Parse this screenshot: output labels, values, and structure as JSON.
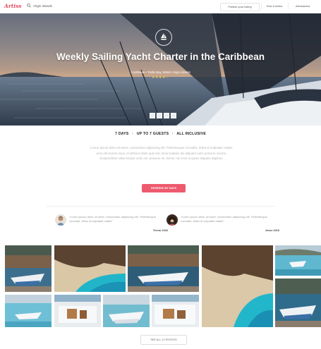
{
  "nav": {
    "logo": "Artiss",
    "search_value": "Virgin Islands",
    "publish_label": "Publish your listing",
    "how_label": "How it works",
    "user_label": "Alessandra"
  },
  "hero": {
    "title": "Weekly Sailing Yacht Charter in the Caribbean",
    "subtitle": "Caribbean • Trellis Bay, British Virgin Islands",
    "rating": 4,
    "stars": "★★★★☆"
  },
  "features": {
    "items": [
      "7 DAYS",
      "UP TO 7 GUESTS",
      "ALL INCLUSIVE"
    ],
    "separator": "·"
  },
  "description": "Lorem ipsum dolor sit amet, consectetur adipiscing elit. Pellentesque convallis, tellus id vulputate mattis, eros elit viverra risus, id ultricies diam quis nisi. Duis sodales dui aliquam nunc posuere viverra. Suspendisse vitae tempor velit, nec posuere mi. Donec vel eros ut quam aliquam dapibus.",
  "cta_label": "RESERVE MY DAYS",
  "testimonials": [
    {
      "quote": "“Lorem ipsum dolor sit amet, consectetur adipiscing elit. Pellentesque convallis, tellus id vulputate mattis”",
      "author": "Trevor 2016"
    },
    {
      "quote": "“Lorem ipsum dolor sit amet, consectetur adipiscing elit. Pellentesque convallis, tellus id vulputate mattis”",
      "author": "Jesse 2016"
    }
  ],
  "see_all_label": "SEE ALL 12 PHOTOS",
  "colors": {
    "accent": "#ee5a6e",
    "star": "#f3c64b"
  }
}
